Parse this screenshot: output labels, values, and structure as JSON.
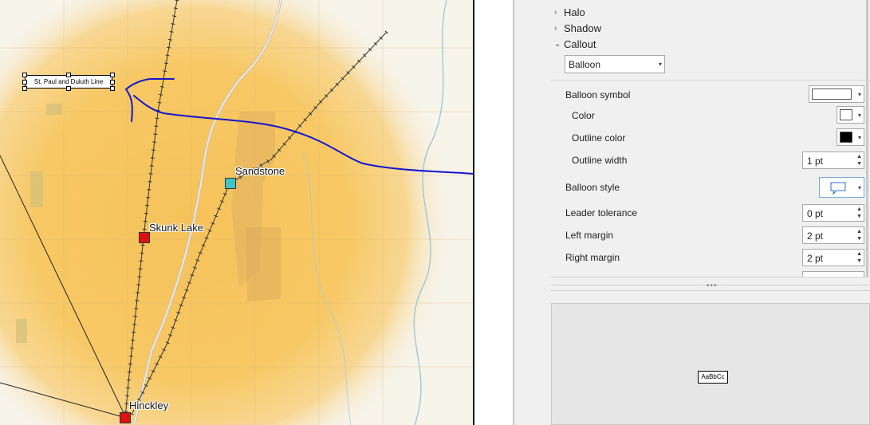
{
  "map": {
    "callout_text": "St. Paul and Duluth Line",
    "cities": [
      {
        "name": "Sandstone",
        "color": "#3fc4c8"
      },
      {
        "name": "Skunk Lake",
        "color": "#dd1111"
      },
      {
        "name": "Hinckley",
        "color": "#dd1111"
      }
    ]
  },
  "panel": {
    "sections": {
      "halo": "Halo",
      "shadow": "Shadow",
      "callout": "Callout"
    },
    "callout_style": "Balloon",
    "properties": {
      "balloon_symbol": "Balloon symbol",
      "color": "Color",
      "outline_color": "Outline color",
      "outline_width": "Outline width",
      "outline_width_value": "1 pt",
      "balloon_style": "Balloon style",
      "leader_tolerance": "Leader tolerance",
      "leader_tolerance_value": "0 pt",
      "left_margin": "Left margin",
      "left_margin_value": "2 pt",
      "right_margin": "Right margin",
      "right_margin_value": "2 pt"
    },
    "preview_text": "AaBbCc"
  },
  "colors": {
    "annotation_blue": "#1616cc",
    "swatch_white": "#ffffff",
    "swatch_black": "#000000"
  }
}
